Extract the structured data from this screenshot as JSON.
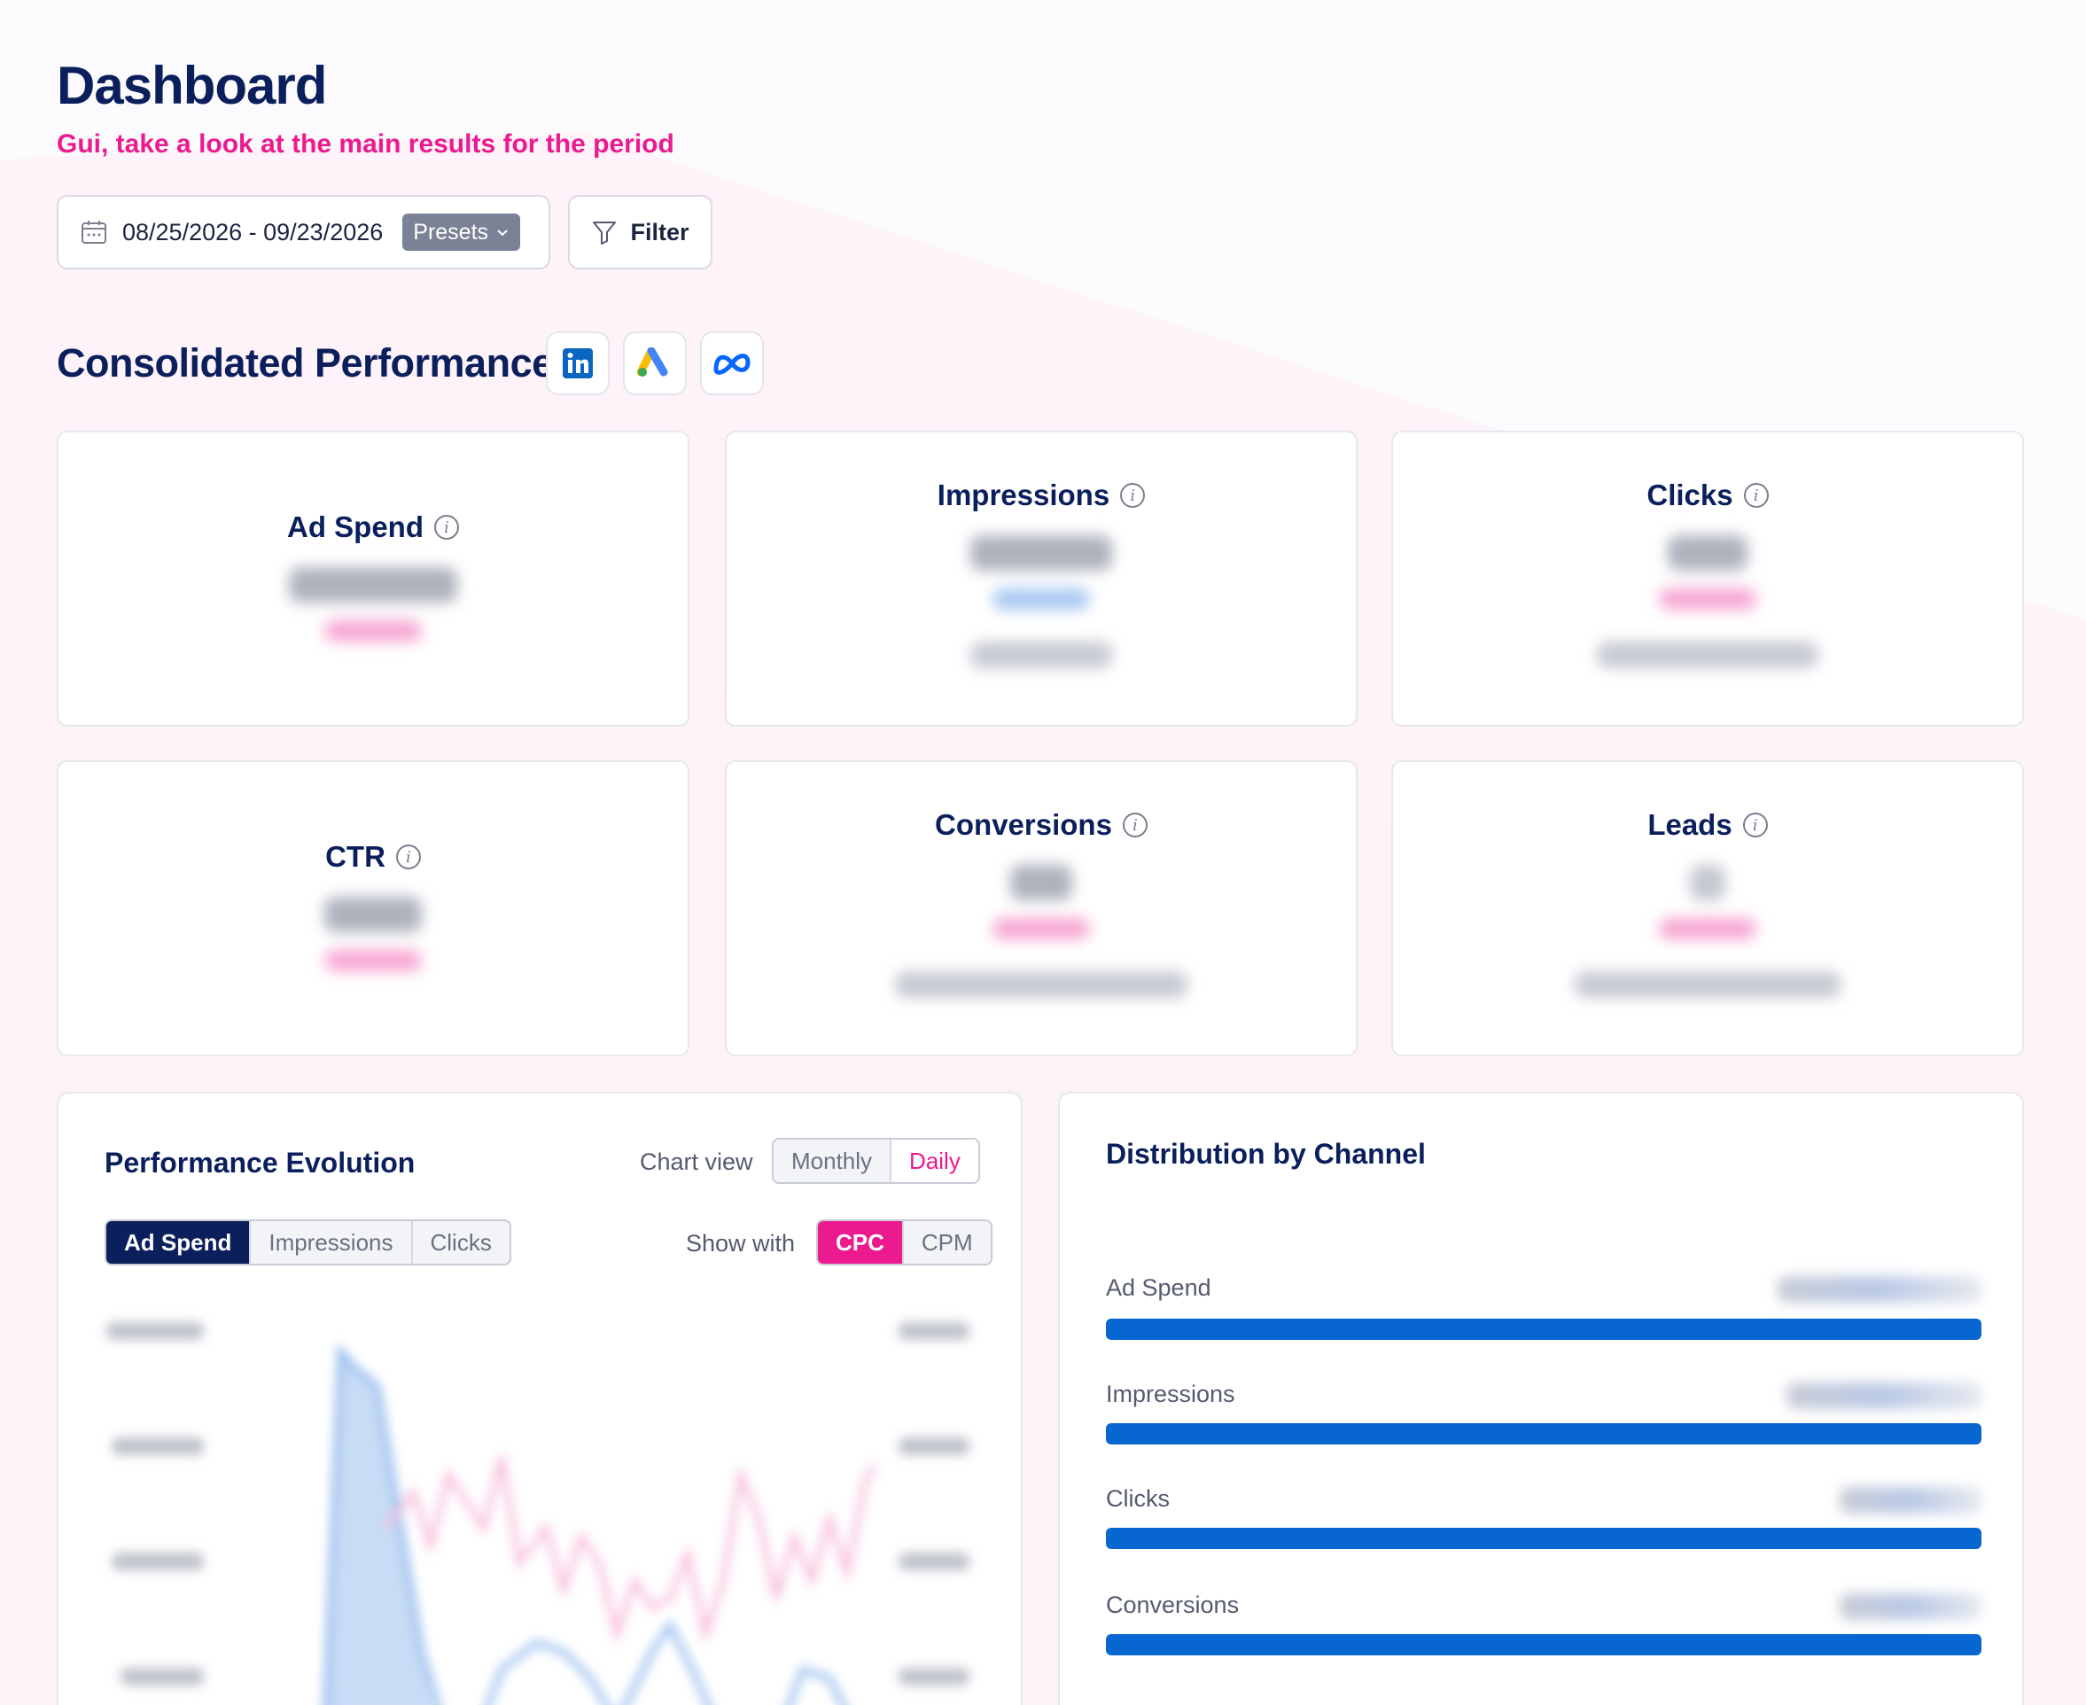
{
  "header": {
    "title": "Dashboard",
    "subtitle": "Gui, take a look at the main results for the period"
  },
  "toolbar": {
    "date_range": "08/25/2026 - 09/23/2026",
    "presets_label": "Presets",
    "filter_label": "Filter"
  },
  "section": {
    "title": "Consolidated Performance",
    "platforms": [
      "linkedin-icon",
      "google-ads-icon",
      "meta-icon"
    ]
  },
  "kpis": [
    {
      "label": "Ad Spend"
    },
    {
      "label": "Impressions"
    },
    {
      "label": "Clicks"
    },
    {
      "label": "CTR"
    },
    {
      "label": "Conversions"
    },
    {
      "label": "Leads"
    }
  ],
  "performance": {
    "title": "Performance Evolution",
    "chart_view_label": "Chart view",
    "chart_view_options": [
      "Monthly",
      "Daily"
    ],
    "chart_view_selected": "Daily",
    "metric_options": [
      "Ad Spend",
      "Impressions",
      "Clicks"
    ],
    "metric_selected": "Ad Spend",
    "show_with_label": "Show with",
    "show_with_options": [
      "CPC",
      "CPM"
    ],
    "show_with_selected": "CPC"
  },
  "distribution": {
    "title": "Distribution by Channel",
    "rows": [
      "Ad Spend",
      "Impressions",
      "Clicks",
      "Conversions"
    ]
  },
  "colors": {
    "navy": "#0b1f5c",
    "pink": "#ec1a8f",
    "blue": "#0866d1"
  }
}
